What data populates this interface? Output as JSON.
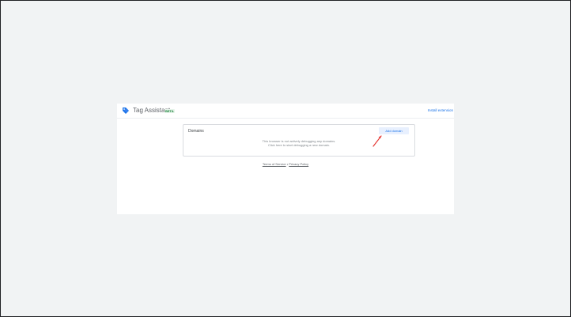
{
  "header": {
    "title": "Tag Assistant",
    "badge": "BETA",
    "install_link": "Install extension"
  },
  "domains_card": {
    "title": "Domains",
    "add_button": "Add domain",
    "empty_line_1": "This browser is not actively debugging any domains.",
    "empty_line_2": "Click here to start debugging a new domain."
  },
  "footer": {
    "terms": "Terms of Service",
    "separator": "•",
    "privacy": "Privacy Policy"
  },
  "icons": {
    "logo": "tag-assistant-logo-icon",
    "annotation": "red-arrow-icon"
  },
  "colors": {
    "accent": "#1a73e8",
    "beta_text": "#188038",
    "beta_bg": "#e6f4ea",
    "button_bg": "#e8f0fe",
    "arrow": "#e53935"
  }
}
